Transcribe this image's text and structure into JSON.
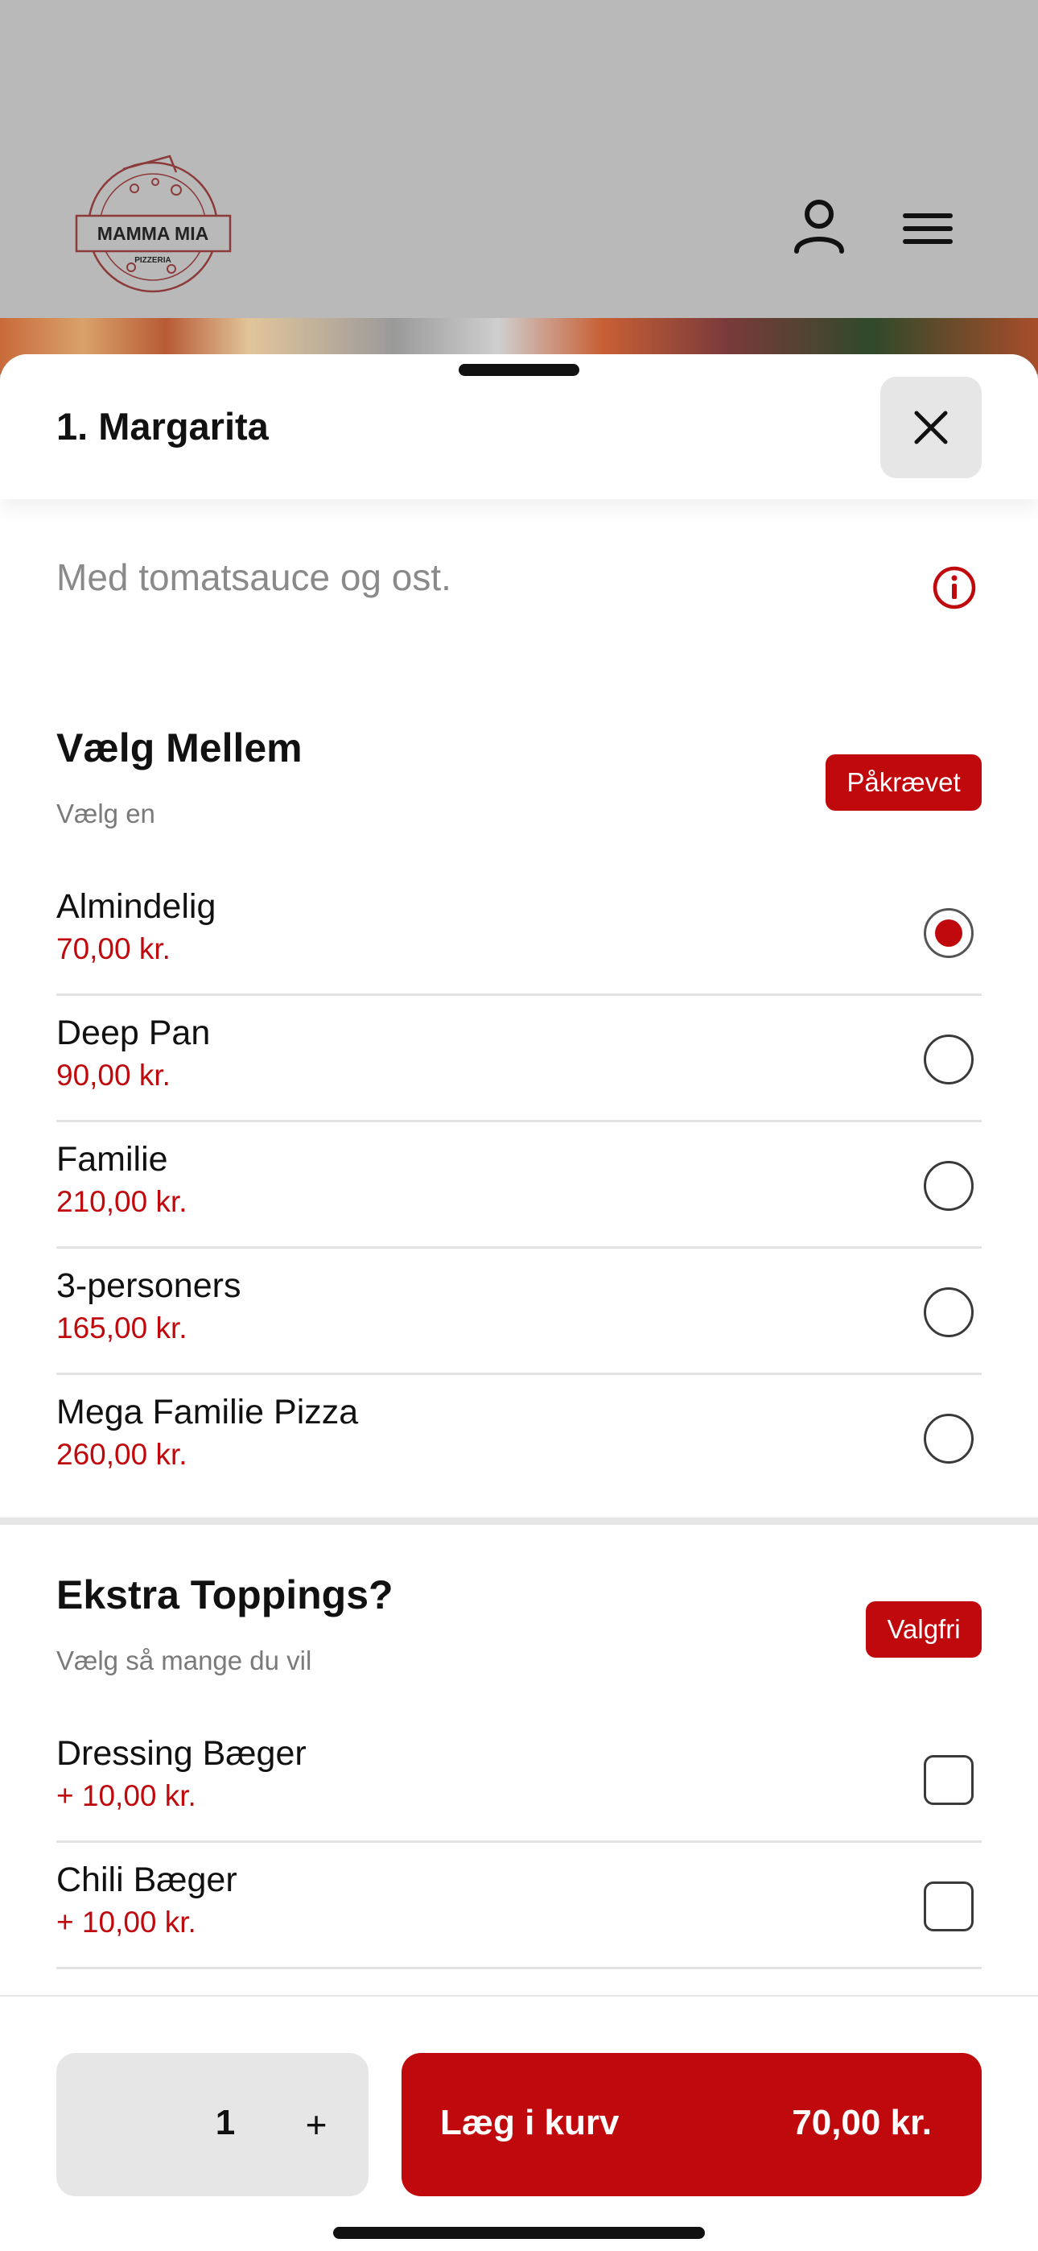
{
  "header": {
    "logo_text": "MAMMA MIA",
    "logo_sub": "PIZZERIA",
    "user_icon": "user-icon",
    "menu_icon": "hamburger-menu-icon"
  },
  "sheet": {
    "title": "1. Margarita",
    "close_icon": "close-icon",
    "description": "Med tomatsauce og ost.",
    "info_icon": "info-icon"
  },
  "size_section": {
    "title": "Vælg Mellem",
    "subtitle": "Vælg en",
    "badge": "Påkrævet",
    "options": [
      {
        "name": "Almindelig",
        "price": "70,00 kr.",
        "selected": true
      },
      {
        "name": "Deep Pan",
        "price": "90,00 kr.",
        "selected": false
      },
      {
        "name": "Familie",
        "price": "210,00 kr.",
        "selected": false
      },
      {
        "name": "3-personers",
        "price": "165,00 kr.",
        "selected": false
      },
      {
        "name": "Mega Familie Pizza",
        "price": "260,00 kr.",
        "selected": false
      }
    ]
  },
  "toppings_section": {
    "title": "Ekstra Toppings?",
    "subtitle": "Vælg så mange du vil",
    "badge": "Valgfri",
    "options": [
      {
        "name": "Dressing Bæger",
        "price": "+ 10,00 kr.",
        "checked": false
      },
      {
        "name": "Chili Bæger",
        "price": "+ 10,00 kr.",
        "checked": false
      }
    ]
  },
  "footer": {
    "quantity": "1",
    "plus": "+",
    "add_label": "Læg i kurv",
    "add_price": "70,00 kr."
  },
  "colors": {
    "accent": "#c0090d",
    "backdrop": "#b9b9b9"
  }
}
